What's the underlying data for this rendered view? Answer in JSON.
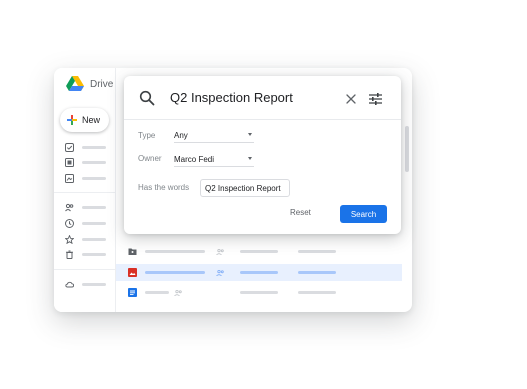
{
  "app": {
    "brand": "Drive",
    "new_button": "New"
  },
  "search": {
    "query": "Q2 Inspection Report",
    "type_label": "Type",
    "type_value": "Any",
    "owner_label": "Owner",
    "owner_value": "Marco Fedi",
    "words_label": "Has the words",
    "words_value": "Q2 Inspection Report",
    "reset_label": "Reset",
    "search_label": "Search"
  },
  "colors": {
    "accent": "#1a73e8",
    "selected_row": "#e8f0fe",
    "placeholder": "#dadce0"
  },
  "icons": {
    "sidebar": [
      "check-box-icon",
      "document-icon",
      "image-icon",
      "people-icon",
      "clock-icon",
      "star-icon",
      "trash-icon",
      "cloud-icon"
    ],
    "files": [
      "folder-shared-icon",
      "image-file-icon",
      "doc-file-icon"
    ]
  }
}
